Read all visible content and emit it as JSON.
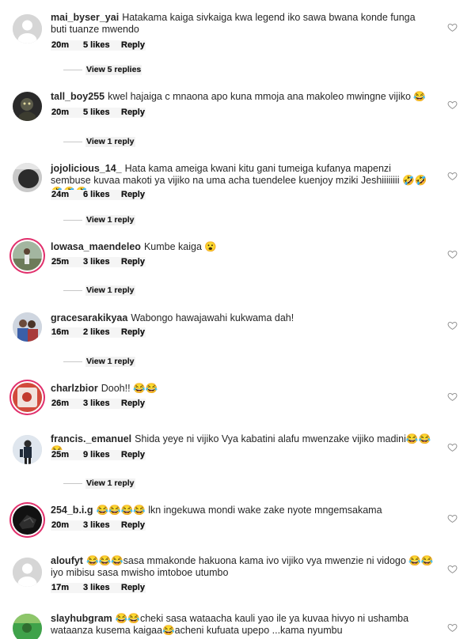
{
  "comments": [
    {
      "username": "mai_byser_yai",
      "text": "Hatakama kaiga sivkaiga kwa legend iko sawa bwana konde funga buti tuanze mwendo",
      "time": "20m",
      "likes": "5 likes",
      "reply": "Reply",
      "view_replies": "View 5 replies",
      "avatar": "default-avatar"
    },
    {
      "username": "tall_boy255",
      "text": "kwel hajaiga c mnaona apo kuna mmoja ana makoleo mwingne vijiko 😂",
      "time": "20m",
      "likes": "5 likes",
      "reply": "Reply",
      "view_replies": "View 1 reply",
      "avatar": "dark-photo-avatar"
    },
    {
      "username": "jojolicious_14_",
      "text": "Hata kama ameiga kwani kitu gani tumeiga kufanya mapenzi sembuse kuvaa makoti ya vijiko na uma acha tuendelee kuenjoy mziki Jeshiiiiiiii 🤣🤣🤣🤣🤣",
      "time": "24m",
      "likes": "6 likes",
      "reply": "Reply",
      "view_replies": "View 1 reply",
      "avatar": "grey-photo-avatar"
    },
    {
      "username": "lowasa_maendeleo",
      "text": "Kumbe kaiga 😮",
      "time": "25m",
      "likes": "3 likes",
      "reply": "Reply",
      "view_replies": "View 1 reply",
      "avatar": "story-ring-avatar"
    },
    {
      "username": "gracesarakikyaa",
      "text": "Wabongo hawajawahi kukwama dah!",
      "time": "16m",
      "likes": "2 likes",
      "reply": "Reply",
      "view_replies": "View 1 reply",
      "avatar": "people-photo-avatar"
    },
    {
      "username": "charlzbior",
      "text": "Dooh!! 😂😂",
      "time": "26m",
      "likes": "3 likes",
      "reply": "Reply",
      "view_replies": "",
      "avatar": "story-ring-avatar-red"
    },
    {
      "username": "francis._emanuel",
      "text": "Shida yeye ni vijiko Vya kabatini alafu mwenzake vijiko madini😂😂😂",
      "time": "25m",
      "likes": "9 likes",
      "reply": "Reply",
      "view_replies": "View 1 reply",
      "avatar": "person-photo-avatar"
    },
    {
      "username": "254_b.i.g",
      "text": "😂😂😂😂 lkn ingekuwa mondi wake zake nyote mngemsakama",
      "time": "20m",
      "likes": "3 likes",
      "reply": "Reply",
      "view_replies": "",
      "avatar": "story-ring-avatar-dark"
    },
    {
      "username": "aloufyt",
      "text": "😂😂😂sasa mmakonde hakuona kama ivo vijiko vya mwenzie ni vidogo 😂😂iyo mibisu sasa mwisho imtoboe utumbo",
      "time": "17m",
      "likes": "3 likes",
      "reply": "Reply",
      "view_replies": "",
      "avatar": "default-avatar"
    },
    {
      "username": "slayhubgram",
      "text": "😂😂cheki sasa wataacha kauli yao ile ya kuvaa hivyo ni ushamba wataanza kusema kaigaa😂acheni kufuata upepo ...kama nyumbu",
      "time": "",
      "likes": "",
      "reply": "",
      "view_replies": "",
      "avatar": "green-photo-avatar"
    }
  ],
  "icons": {
    "like": "heart-outline-icon"
  },
  "colors": {
    "story_ring": "#e1306c",
    "text": "#262626",
    "secondary": "#8e8e8e"
  }
}
